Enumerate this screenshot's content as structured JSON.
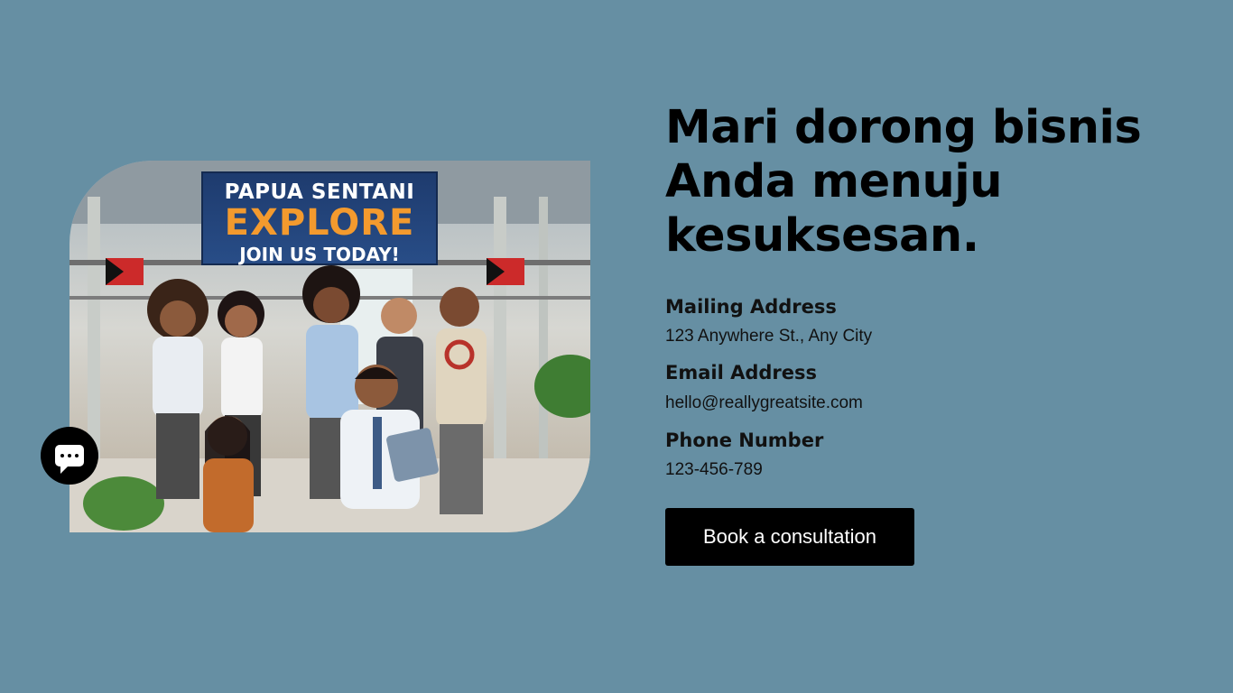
{
  "hero": {
    "banner_line1": "PAPUA SENTANI",
    "banner_line2": "EXPLORE",
    "banner_line3": "JOIN US TODAY!"
  },
  "headline": "Mari dorong bisnis Anda menuju kesuksesan.",
  "contact": {
    "mailing_label": "Mailing Address",
    "mailing_value": "123 Anywhere St., Any City",
    "email_label": "Email Address",
    "email_value": "hello@reallygreatsite.com",
    "phone_label": "Phone Number",
    "phone_value": "123-456-789"
  },
  "cta_label": "Book a consultation",
  "chat": {
    "icon": "chat-icon"
  },
  "colors": {
    "background": "#668fa3",
    "button": "#000000",
    "button_text": "#ffffff"
  }
}
